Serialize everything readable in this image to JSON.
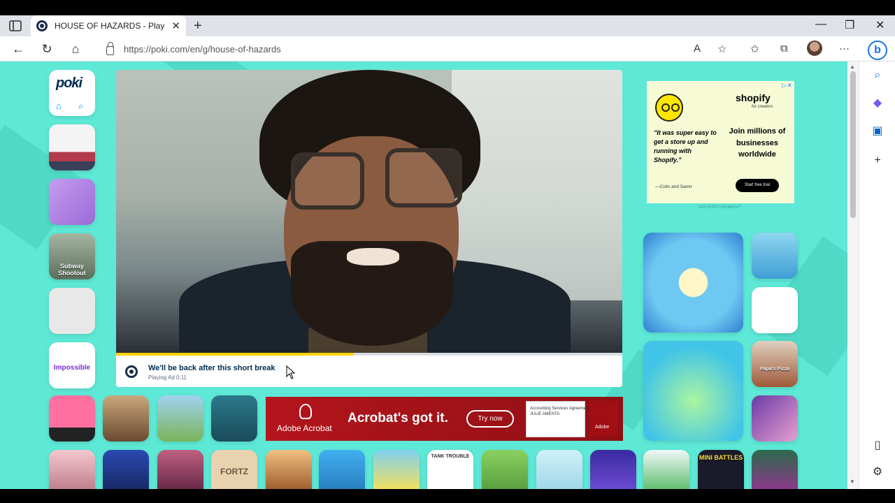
{
  "browser": {
    "tab_title": "HOUSE OF HAZARDS - Play Hou",
    "url": "https://poki.com/en/g/house-of-hazards"
  },
  "site": {
    "logo": "poki"
  },
  "player": {
    "ad_title": "We'll be back after this short break",
    "ad_subtitle": "Playing Ad 0:11",
    "progress_fraction": 0.47
  },
  "shopify_ad": {
    "brand": "shopify",
    "brand_sub": "for creators",
    "quote": "\"It was super easy to get a store up and running with Shopify.\"",
    "author": "—Colin and Samir",
    "headline": "Join millions of businesses worldwide",
    "cta": "Start free trial",
    "caption": "ADVERTISEMENT"
  },
  "adobe_ad": {
    "brand": "Adobe Acrobat",
    "headline": "Acrobat's got it.",
    "cta": "Try now",
    "doc_text": "Accounting Services Agreement\nJULIE AMENTA",
    "logo_label": "Adobe"
  },
  "game_labels": {
    "subway": "Subway Shootout",
    "impossible": "Impossible",
    "fortz": "FORTZ",
    "tank": "TANK TROUBLE",
    "mini": "MINI BATTLES",
    "pizza": "Papa's Pizza"
  }
}
